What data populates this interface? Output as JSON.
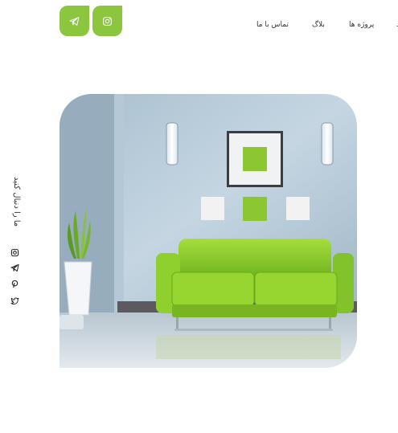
{
  "nav": {
    "items": [
      {
        "label": "تماس با ما"
      },
      {
        "label": "بلاگ"
      },
      {
        "label": "پروژه ها"
      }
    ]
  },
  "social_buttons": [
    {
      "icon": "telegram-icon"
    },
    {
      "icon": "instagram-icon"
    }
  ],
  "sidebar": {
    "follow_text": "ما را دنبال کنید",
    "icons": [
      "instagram-icon",
      "telegram-icon",
      "pinterest-icon",
      "twitter-icon"
    ]
  },
  "hero": {
    "image": "living-room-green-sofa"
  },
  "colors": {
    "accent": "#8cc63f"
  }
}
